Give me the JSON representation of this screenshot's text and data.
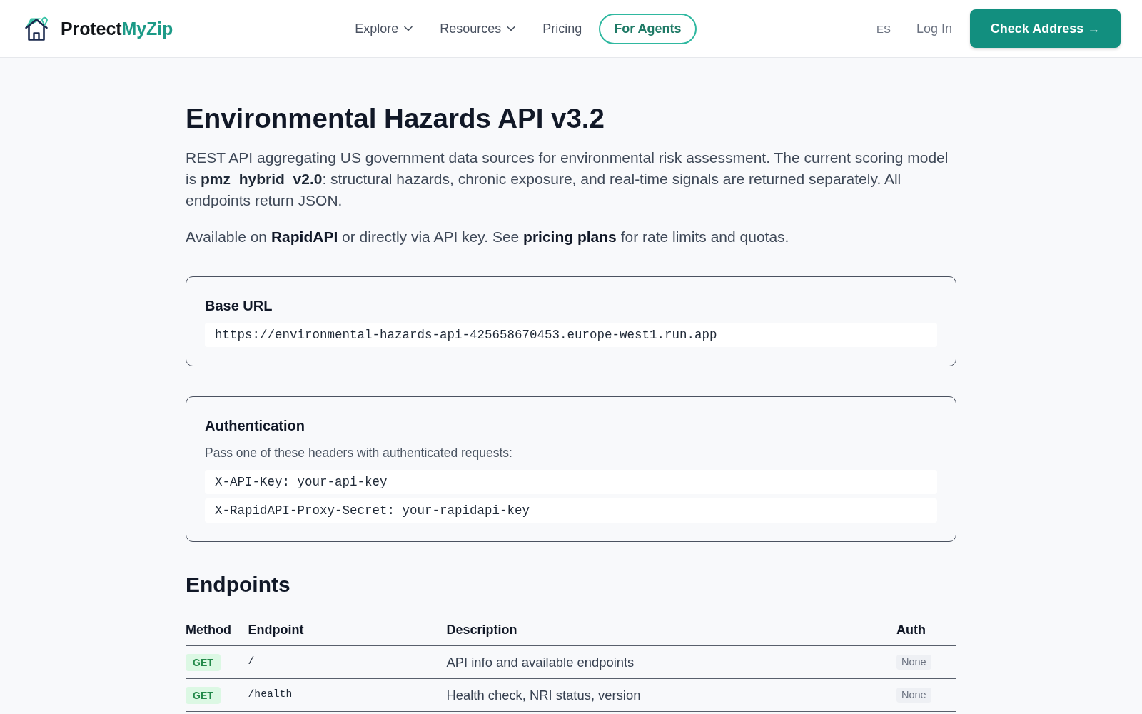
{
  "header": {
    "brand": {
      "text": "Protect",
      "accent": "MyZip"
    },
    "nav": [
      {
        "label": "Explore",
        "kind": "dropdown"
      },
      {
        "label": "Resources",
        "kind": "dropdown"
      },
      {
        "label": "Pricing",
        "kind": "link"
      },
      {
        "label": "For Agents",
        "kind": "outlined"
      }
    ],
    "language": "ES",
    "login": "Log In",
    "cta": "Check Address →"
  },
  "title": "Environmental Hazards API v3.2",
  "intro": "REST API aggregating US government data sources for environmental risk assessment. The current scoring model is **pmz_hybrid_v2.0**: structural hazards, chronic exposure, and real-time signals are returned separately. All endpoints return JSON.",
  "availability": [
    {
      "text": "Available on ",
      "kind": "text"
    },
    {
      "text": "RapidAPI",
      "kind": "link"
    },
    {
      "text": " or directly via API key. See ",
      "kind": "text"
    },
    {
      "text": "pricing plans",
      "kind": "link"
    },
    {
      "text": " for rate limits and quotas.",
      "kind": "text"
    }
  ],
  "cards": [
    {
      "heading": "Base URL",
      "code": [
        "https://environmental-hazards-api-425658670453.europe-west1.run.app"
      ]
    },
    {
      "heading": "Authentication",
      "description": "Pass one of these headers with authenticated requests:",
      "code": [
        "X-API-Key: your-api-key",
        "X-RapidAPI-Proxy-Secret: your-rapidapi-key"
      ]
    }
  ],
  "endpoints": {
    "heading": "Endpoints",
    "columns": [
      "Method",
      "Endpoint",
      "Description",
      "Auth"
    ],
    "rows": [
      {
        "method": "GET",
        "path": "/",
        "description": "API info and available endpoints",
        "auth": "None"
      },
      {
        "method": "GET",
        "path": "/health",
        "description": "Health check, NRI status, version",
        "auth": "None"
      }
    ]
  }
}
